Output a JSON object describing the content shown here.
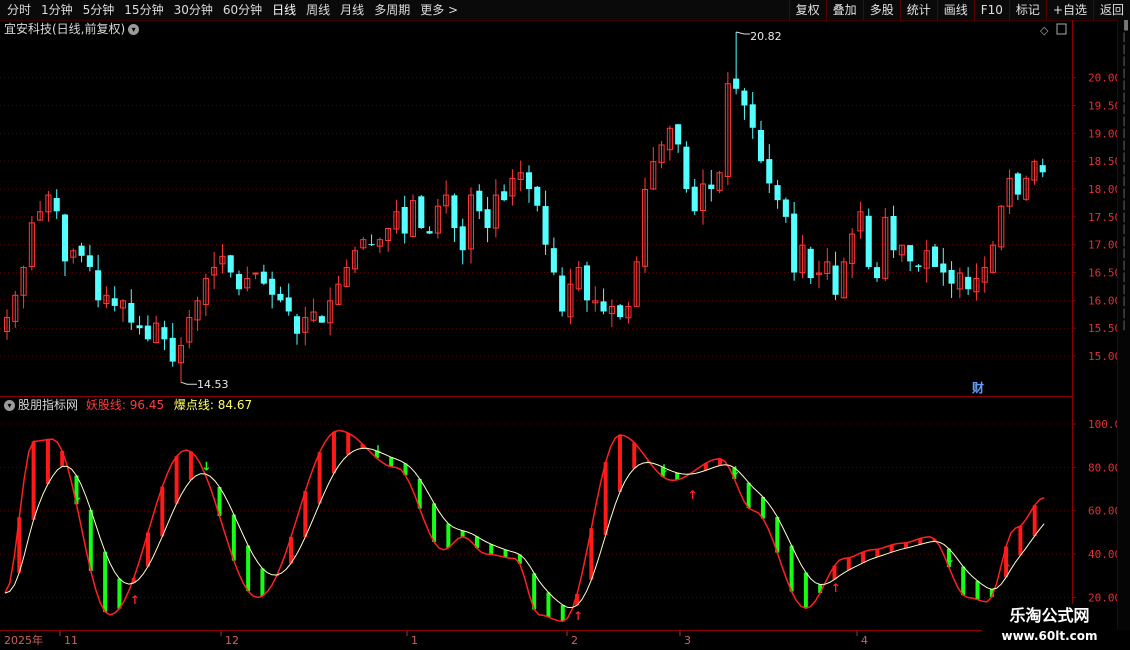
{
  "toolbar": {
    "periods": [
      "分时",
      "1分钟",
      "5分钟",
      "15分钟",
      "30分钟",
      "60分钟",
      "日线",
      "周线",
      "月线",
      "多周期",
      "更多"
    ],
    "active_period": "日线",
    "more_arrow": ">",
    "right_buttons": [
      "复权",
      "叠加",
      "多股",
      "统计",
      "画线",
      "F10",
      "标记",
      "+自选",
      "返回"
    ]
  },
  "main_chart": {
    "title": "宜安科技(日线,前复权)",
    "high_label": "20.82",
    "low_label": "14.53",
    "cai_label": "财",
    "y_ticks": [
      "20.00",
      "19.50",
      "19.00",
      "18.50",
      "18.00",
      "17.50",
      "17.00",
      "16.50",
      "16.00",
      "15.50",
      "15.00"
    ]
  },
  "indicator": {
    "name": "股朋指标网",
    "line1_label": "妖股线:",
    "line1_value": "96.45",
    "line2_label": "爆点线:",
    "line2_value": "84.67",
    "y_ticks": [
      "100.0",
      "80.00",
      "60.00",
      "40.00",
      "20.00"
    ]
  },
  "date_axis": {
    "year_label": "2025年",
    "months": [
      "11",
      "12",
      "1",
      "2",
      "3",
      "4"
    ]
  },
  "watermark": {
    "title": "乐淘公式网",
    "url": "www.60lt.com"
  },
  "colors": {
    "up": "#ff3a3a",
    "down": "#54ffff",
    "bull": "#ff1a1a",
    "bear": "#14ff14",
    "axis": "#8a0000",
    "grid": "#550000"
  },
  "chart_data": {
    "type": "candlestick",
    "price_range": [
      14.3,
      21.0
    ],
    "indicator_range": [
      5,
      112
    ],
    "high_point": 20.82,
    "low_point": 14.53,
    "close": [
      15.7,
      16.1,
      16.6,
      17.4,
      17.6,
      17.9,
      17.6,
      16.7,
      16.9,
      16.8,
      16.6,
      16.0,
      16.1,
      15.9,
      16.0,
      15.6,
      15.5,
      15.3,
      15.6,
      15.3,
      14.9,
      15.2,
      15.7,
      16.0,
      16.4,
      16.6,
      16.8,
      16.5,
      16.2,
      16.4,
      16.5,
      16.3,
      16.1,
      16.0,
      15.8,
      15.4,
      15.7,
      15.8,
      15.6,
      16.0,
      16.3,
      16.6,
      16.9,
      17.1,
      17.0,
      17.1,
      17.3,
      17.6,
      17.2,
      17.8,
      17.3,
      17.2,
      17.7,
      17.9,
      17.3,
      16.9,
      17.9,
      17.6,
      17.3,
      17.9,
      17.8,
      18.2,
      18.3,
      18.0,
      17.7,
      17.0,
      16.5,
      15.8,
      16.3,
      16.6,
      16.0,
      16.0,
      15.8,
      15.9,
      15.7,
      15.9,
      16.7,
      18.0,
      18.5,
      18.8,
      19.1,
      18.8,
      18.0,
      17.6,
      18.1,
      18.0,
      18.3,
      19.9,
      19.8,
      19.5,
      19.1,
      18.5,
      18.1,
      17.8,
      17.5,
      16.5,
      17.0,
      16.4,
      16.5,
      16.7,
      16.1,
      16.7,
      17.2,
      17.6,
      16.6,
      16.4,
      17.5,
      16.9,
      17.0,
      16.7,
      16.6,
      16.9,
      16.6,
      16.5,
      16.3,
      16.5,
      16.2,
      16.4,
      16.6,
      17.0,
      17.7,
      18.2,
      17.9,
      18.2,
      18.5,
      18.3
    ]
  }
}
